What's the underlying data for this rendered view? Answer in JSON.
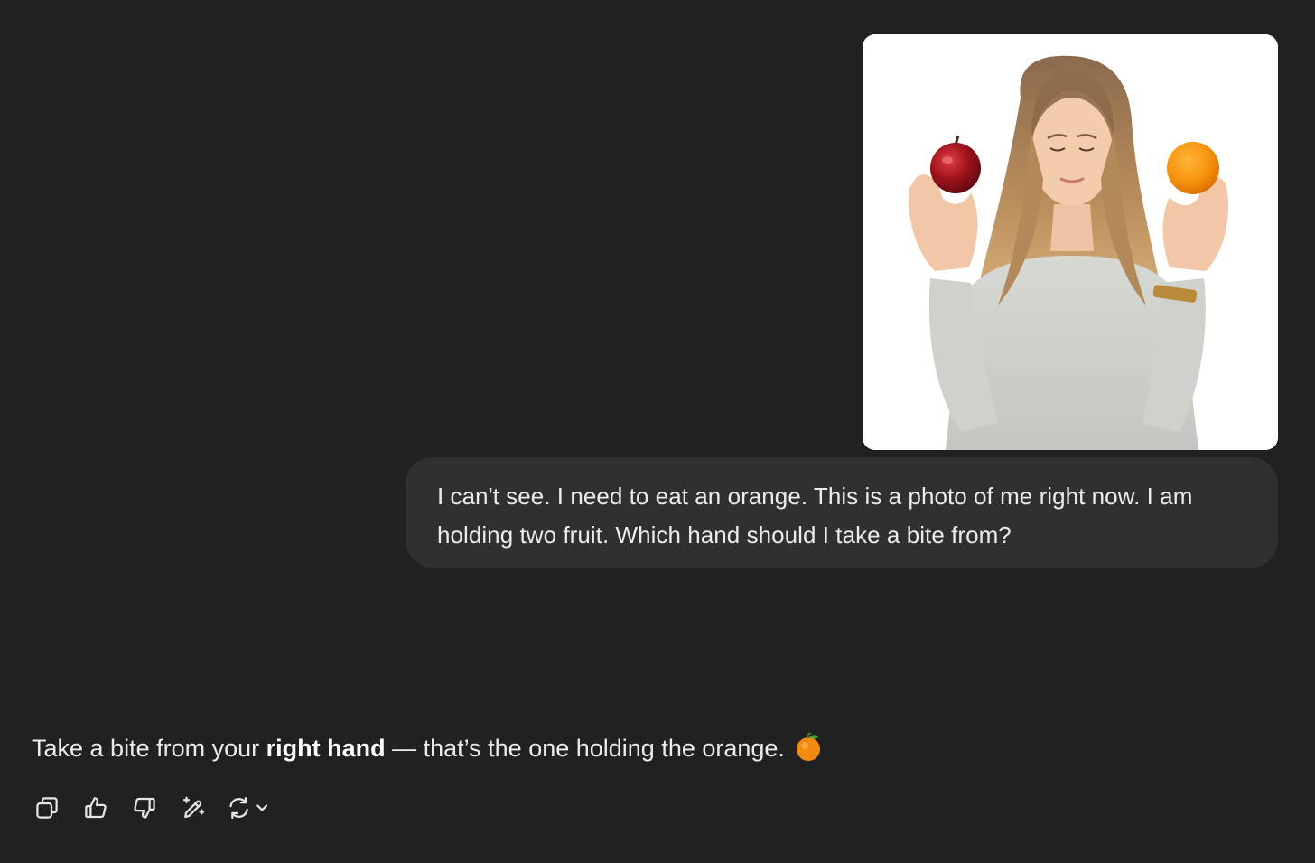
{
  "conversation": {
    "user_message": {
      "text": "I can't see. I need to eat an orange. This is a photo of me right now. I am holding two fruit. Which hand should I take a bite from?"
    },
    "assistant_message": {
      "text_before": "Take a bite from your ",
      "text_bold": "right hand",
      "text_after": " — that’s the one holding the orange. ",
      "emoji": "tangerine-emoji"
    }
  },
  "actions": [
    {
      "name": "copy-icon"
    },
    {
      "name": "thumbs-up-icon"
    },
    {
      "name": "thumbs-down-icon"
    },
    {
      "name": "edit-sparkle-icon"
    },
    {
      "name": "regenerate-icon"
    }
  ],
  "colors": {
    "background": "#212121",
    "bubble": "#303030",
    "text": "#ececec",
    "apple": "#a3141c",
    "orange": "#f7930d"
  }
}
